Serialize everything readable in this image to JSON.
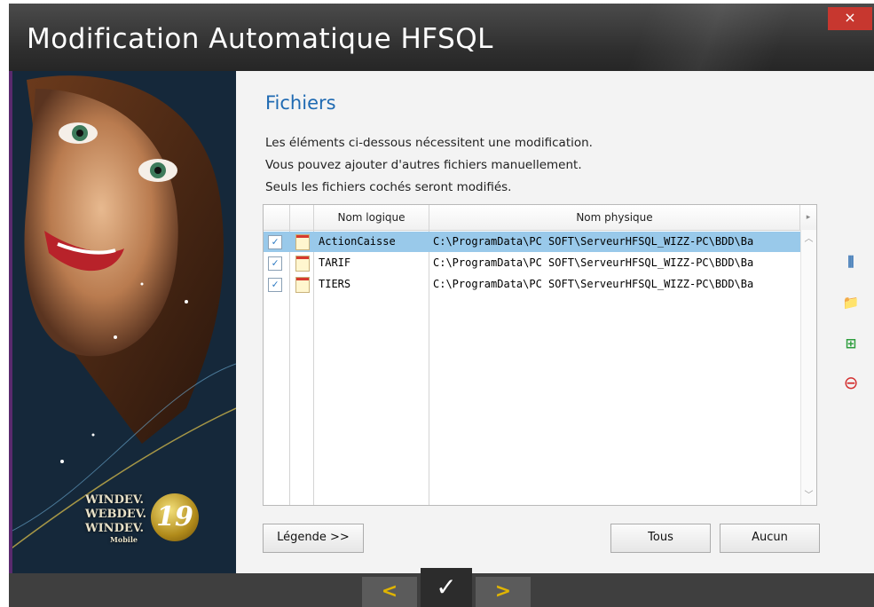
{
  "window": {
    "title": "Modification Automatique HFSQL",
    "close_label": "×"
  },
  "branding": {
    "logo_lines": [
      "WINDEV.",
      "WEBDEV.",
      "WINDEV."
    ],
    "logo_sub": "Mobile",
    "version_badge": "19"
  },
  "page": {
    "heading": "Fichiers",
    "description": [
      "Les éléments ci-dessous nécessitent une modification.",
      "Vous pouvez ajouter d'autres fichiers manuellement.",
      "Seuls les fichiers cochés seront modifiés."
    ]
  },
  "table": {
    "columns": [
      "",
      "",
      "Nom logique",
      "Nom physique"
    ],
    "rows": [
      {
        "checked": true,
        "logical": "ActionCaisse",
        "physical": "C:\\ProgramData\\PC SOFT\\ServeurHFSQL_WIZZ-PC\\BDD\\Ba",
        "selected": true
      },
      {
        "checked": true,
        "logical": "TARIF",
        "physical": "C:\\ProgramData\\PC SOFT\\ServeurHFSQL_WIZZ-PC\\BDD\\Ba",
        "selected": false
      },
      {
        "checked": true,
        "logical": "TIERS",
        "physical": "C:\\ProgramData\\PC SOFT\\ServeurHFSQL_WIZZ-PC\\BDD\\Ba",
        "selected": false
      }
    ],
    "check_glyph": "✓"
  },
  "side_buttons": [
    "column-icon",
    "add-folder-icon",
    "add-file-icon",
    "remove-icon"
  ],
  "buttons": {
    "legend": "Légende >>",
    "all": "Tous",
    "none": "Aucun"
  },
  "nav": {
    "prev": "<",
    "finish": "✓",
    "next": ">"
  },
  "colors": {
    "heading": "#1f6ab2",
    "selection": "#99c9ea",
    "title_bar": "#333333",
    "nav_accent": "#e0b400"
  }
}
